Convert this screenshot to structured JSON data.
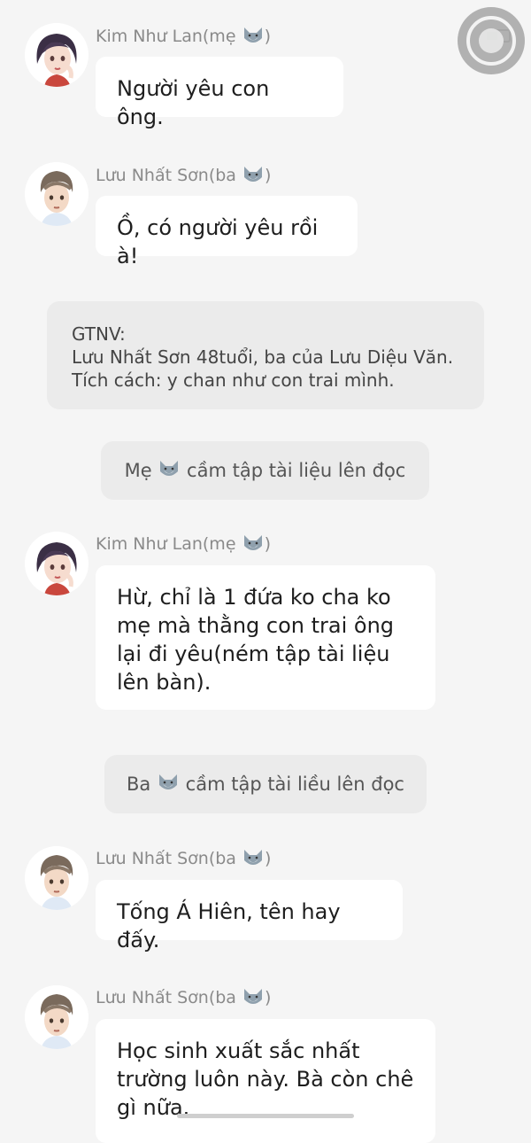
{
  "messages": [
    {
      "type": "chat",
      "speaker": "Kim Như Lan(mẹ",
      "character": "mother",
      "text": [
        "Người yêu con ông."
      ]
    },
    {
      "type": "chat",
      "speaker": "Lưu Nhất Sơn(ba",
      "character": "father",
      "text": [
        "Ồ, có người yêu rồi à!"
      ]
    },
    {
      "type": "note",
      "text": [
        "GTNV:",
        "Lưu Nhất Sơn 48tuổi, ba của Lưu Diệu Văn.",
        "Tích cách: y chan như con trai mình."
      ]
    },
    {
      "type": "narration",
      "before": "Mẹ",
      "after": "cầm tập tài liệu lên đọc"
    },
    {
      "type": "chat",
      "speaker": "Kim Như Lan(mẹ",
      "character": "mother",
      "text": [
        "Hừ, chỉ là 1 đứa ko cha ko",
        "mẹ mà thằng con trai ông",
        "lại đi yêu(ném tập tài liệu",
        "lên bàn)."
      ]
    },
    {
      "type": "narration",
      "before": "Ba",
      "after": "cầm tập tài liều lên đọc"
    },
    {
      "type": "chat",
      "speaker": "Lưu Nhất Sơn(ba",
      "character": "father",
      "text": [
        "Tống Á Hiên, tên hay đấy."
      ]
    },
    {
      "type": "chat",
      "speaker": "Lưu Nhất Sơn(ba",
      "character": "father",
      "text": [
        "Học sinh xuất sắc nhất",
        "trường luôn này. Bà còn chê",
        "gì nữa."
      ]
    }
  ],
  "icons": {
    "speaker_suffix": "wolf-emoji-icon",
    "scroll_button": "floating-scroll-button",
    "battery": "battery-icon"
  },
  "colors": {
    "background": "#f5f5f5",
    "bubble": "#ffffff",
    "note": "#ebebeb",
    "name": "#8a8a8a"
  }
}
